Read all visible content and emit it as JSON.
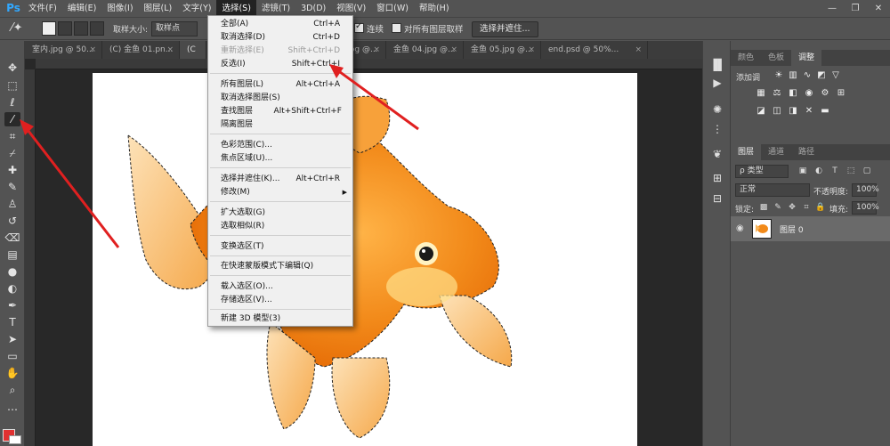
{
  "app": {
    "logo": "Ps"
  },
  "menubar": {
    "items": [
      "文件(F)",
      "编辑(E)",
      "图像(I)",
      "图层(L)",
      "文字(Y)",
      "选择(S)",
      "滤镜(T)",
      "3D(D)",
      "视图(V)",
      "窗口(W)",
      "帮助(H)"
    ],
    "active": "选择(S)"
  },
  "window": {
    "minimize": "—",
    "restore": "❐",
    "close": "✕"
  },
  "options": {
    "sample_size_label": "取样大小:",
    "sample_size_value": "取样点",
    "contiguous_label": "连续",
    "sample_all_layers_label": "对所有图层取样",
    "select_mask_button": "选择并遮住..."
  },
  "tabs": [
    {
      "label": "室内.jpg @ 50...",
      "close": "×"
    },
    {
      "label": "(C) 金鱼 01.pn...",
      "close": "×"
    },
    {
      "label": "(C",
      "close": ""
    },
    {
      "label": "金鱼 03.jpg @...",
      "close": "×"
    },
    {
      "label": "金鱼 04.jpg @...",
      "close": "×"
    },
    {
      "label": "金鱼 05.jpg @...",
      "close": "×"
    },
    {
      "label": "end.psd @ 50%...",
      "close": "×"
    }
  ],
  "select_menu": {
    "items": [
      {
        "label": "全部(A)",
        "shortcut": "Ctrl+A"
      },
      {
        "label": "取消选择(D)",
        "shortcut": "Ctrl+D"
      },
      {
        "label": "重新选择(E)",
        "shortcut": "Shift+Ctrl+D",
        "disabled": true
      },
      {
        "label": "反选(I)",
        "shortcut": "Shift+Ctrl+I"
      },
      {
        "label": "所有图层(L)",
        "shortcut": "Alt+Ctrl+A"
      },
      {
        "label": "取消选择图层(S)",
        "shortcut": ""
      },
      {
        "label": "查找图层",
        "shortcut": "Alt+Shift+Ctrl+F"
      },
      {
        "label": "隔离图层",
        "shortcut": ""
      },
      {
        "label": "色彩范围(C)...",
        "shortcut": ""
      },
      {
        "label": "焦点区域(U)...",
        "shortcut": ""
      },
      {
        "label": "选择并遮住(K)...",
        "shortcut": "Alt+Ctrl+R"
      },
      {
        "label": "修改(M)",
        "shortcut": ""
      },
      {
        "label": "扩大选取(G)",
        "shortcut": ""
      },
      {
        "label": "选取相似(R)",
        "shortcut": ""
      },
      {
        "label": "变换选区(T)",
        "shortcut": ""
      },
      {
        "label": "在快速蒙版模式下编辑(Q)",
        "shortcut": ""
      },
      {
        "label": "载入选区(O)...",
        "shortcut": ""
      },
      {
        "label": "存储选区(V)...",
        "shortcut": ""
      },
      {
        "label": "新建 3D 模型(3)",
        "shortcut": ""
      }
    ]
  },
  "panels": {
    "top_tabs": [
      "颜色",
      "色板",
      "调整"
    ],
    "adjust_label": "添加调",
    "layer_tabs": [
      "图层",
      "通道",
      "路径"
    ],
    "kind_filter": "ρ 类型",
    "blend_mode": "正常",
    "opacity_label": "不透明度:",
    "opacity_value": "100%",
    "lock_label": "锁定:",
    "fill_label": "填充:",
    "fill_value": "100%",
    "layer_name": "图层 0"
  },
  "colors": {
    "foreground": "#e03030",
    "background": "#ffffff",
    "fish": "#f28a1a"
  }
}
